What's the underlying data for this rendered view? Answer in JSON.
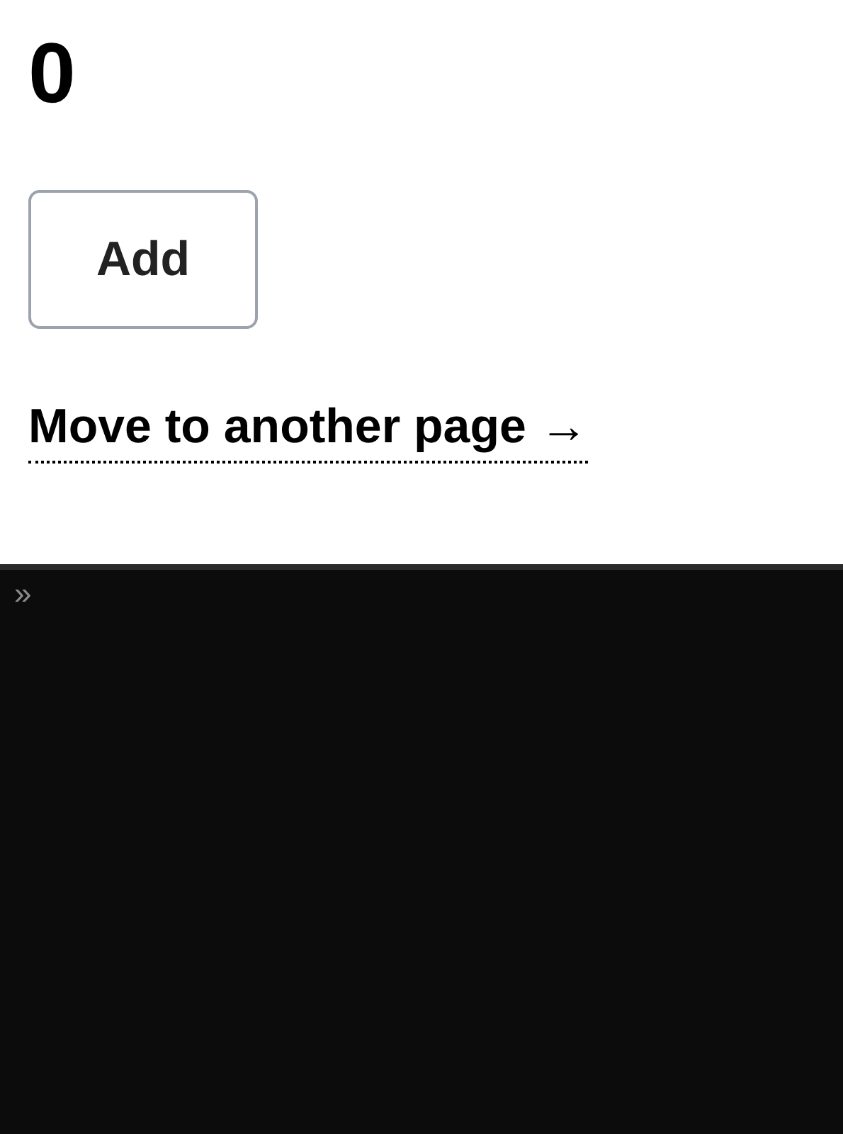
{
  "counter": "0",
  "add_button": "Add",
  "link": "Move to another page →",
  "console": {
    "prompt": "»"
  }
}
